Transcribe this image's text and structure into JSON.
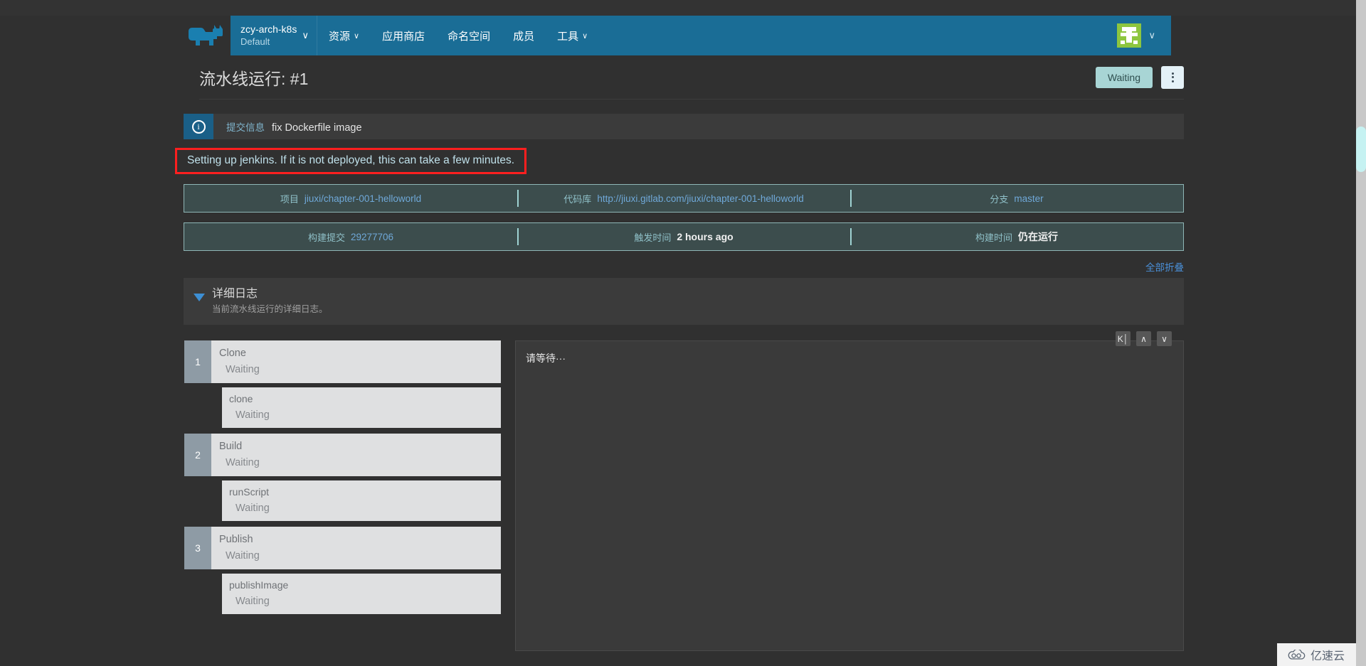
{
  "header": {
    "logo_icon": "ox-logo-icon",
    "cluster": {
      "name": "zcy-arch-k8s",
      "sub": "Default",
      "caret": "∨"
    },
    "nav": [
      {
        "label": "资源",
        "caret": "∨"
      },
      {
        "label": "应用商店",
        "caret": ""
      },
      {
        "label": "命名空间",
        "caret": ""
      },
      {
        "label": "成员",
        "caret": ""
      },
      {
        "label": "工具",
        "caret": "∨"
      }
    ],
    "avatar_caret": "∨"
  },
  "page": {
    "title": "流水线运行: #1",
    "status_badge": "Waiting",
    "kebab_label": "⋮"
  },
  "commit": {
    "icon": "info-circle-icon",
    "icon_glyph": "i",
    "label": "提交信息",
    "message": "fix Dockerfile image"
  },
  "notice": {
    "text": "Setting up jenkins. If it is not deployed, this can take a few minutes.",
    "border_color": "#ff1f1f"
  },
  "meta_rows": [
    [
      {
        "label": "项目",
        "value": "jiuxi/chapter-001-helloworld",
        "style": "link"
      },
      {
        "label": "代码库",
        "value": "http://jiuxi.gitlab.com/jiuxi/chapter-001-helloworld",
        "style": "link"
      },
      {
        "label": "分支",
        "value": "master",
        "style": "link"
      }
    ],
    [
      {
        "label": "构建提交",
        "value": "29277706",
        "style": "link"
      },
      {
        "label": "触发时间",
        "value": "2 hours ago",
        "style": "strong"
      },
      {
        "label": "构建时间",
        "value": "仍在运行",
        "style": "strong"
      }
    ]
  ],
  "collapse_all": "全部折叠",
  "log_section": {
    "title": "详细日志",
    "subtitle": "当前流水线运行的详细日志。",
    "toggle_icon": "triangle-down-icon"
  },
  "stages": [
    {
      "num": "1",
      "name": "Clone",
      "status": "Waiting",
      "step": {
        "name": "clone",
        "status": "Waiting"
      }
    },
    {
      "num": "2",
      "name": "Build",
      "status": "Waiting",
      "step": {
        "name": "runScript",
        "status": "Waiting"
      }
    },
    {
      "num": "3",
      "name": "Publish",
      "status": "Waiting",
      "step": {
        "name": "publishImage",
        "status": "Waiting"
      }
    }
  ],
  "log_panel": {
    "text": "请等待···",
    "controls": [
      {
        "name": "jump-to-top-button",
        "glyph": "K│"
      },
      {
        "name": "scroll-up-button",
        "glyph": "∧"
      },
      {
        "name": "scroll-down-button",
        "glyph": "∨"
      }
    ]
  },
  "watermark": {
    "text": "亿速云",
    "icon": "cloud-icon"
  },
  "colors": {
    "nav_blue": "#1a6d96",
    "page_bg": "#303030",
    "accent_link": "#4a90d9",
    "badge_waiting": "#a8d5d5",
    "meta_panel": "#3c4d4d",
    "notice_border": "#ff1f1f",
    "stage_card": "#dfe0e1",
    "stage_num": "#8e9ba5",
    "avatar_green": "#8dc63f"
  }
}
